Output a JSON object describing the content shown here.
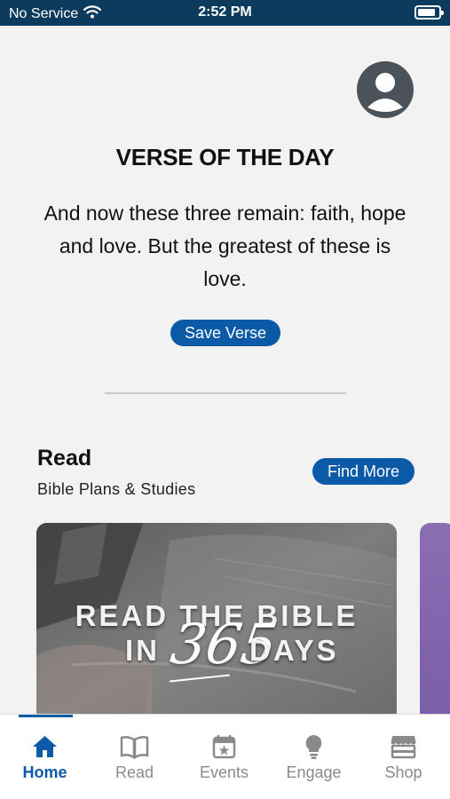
{
  "status": {
    "carrier": "No Service",
    "time": "2:52 PM"
  },
  "verse": {
    "title": "VERSE OF THE DAY",
    "text": "And now these three remain: faith, hope and love. But the greatest of these is love.",
    "save_label": "Save Verse"
  },
  "read": {
    "title": "Read",
    "subtitle": "Bible Plans & Studies",
    "find_more_label": "Find More",
    "card": {
      "line1": "READ THE BIBLE",
      "line2_left": "IN",
      "line2_number": "365",
      "line2_right": "DAYS"
    }
  },
  "tabs": [
    {
      "label": "Home",
      "icon": "home-icon",
      "active": true
    },
    {
      "label": "Read",
      "icon": "book-icon",
      "active": false
    },
    {
      "label": "Events",
      "icon": "calendar-icon",
      "active": false
    },
    {
      "label": "Engage",
      "icon": "lightbulb-icon",
      "active": false
    },
    {
      "label": "Shop",
      "icon": "store-icon",
      "active": false
    }
  ],
  "colors": {
    "accent": "#0b5aa8",
    "status_bar": "#0d3b5e",
    "tab_inactive": "#8a8a8a"
  }
}
